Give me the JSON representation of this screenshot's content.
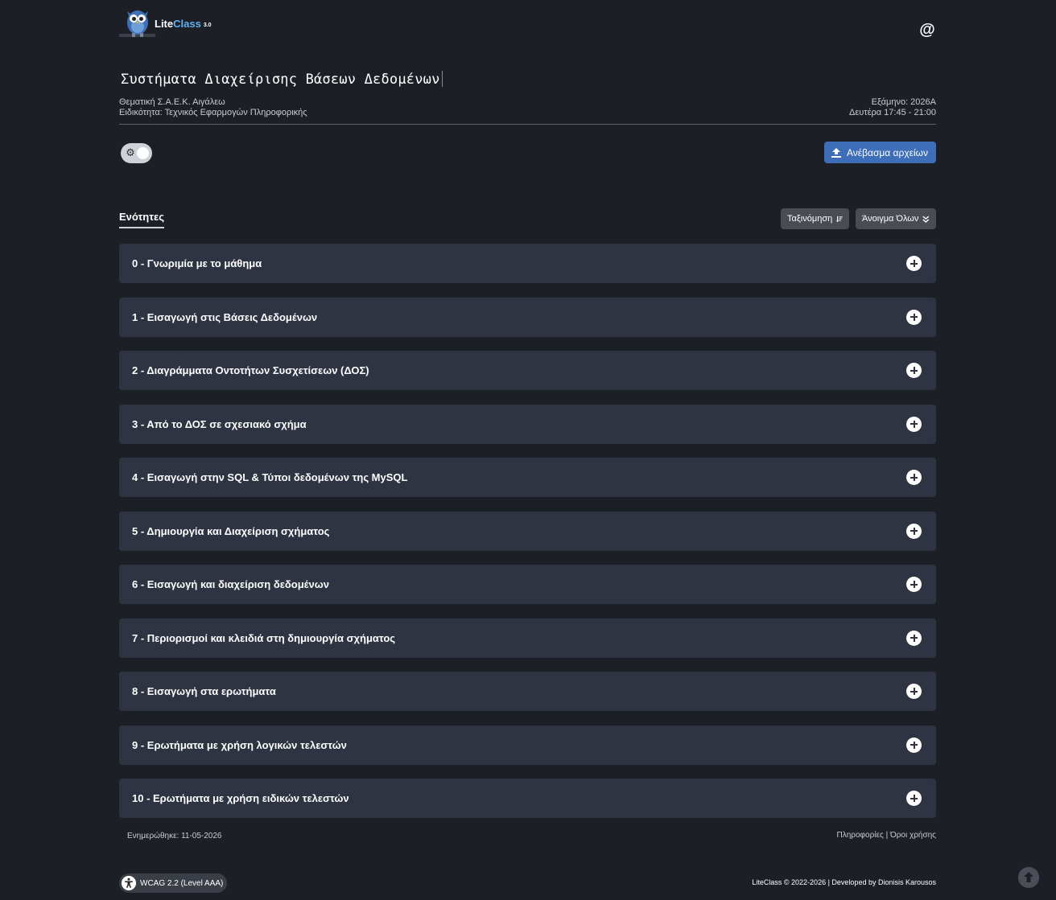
{
  "header": {
    "brand_lite": "Lite",
    "brand_class": "Class",
    "brand_version": "3.0",
    "contact_icon": "@"
  },
  "course": {
    "title": "Συστήματα Διαχείρισης Βάσεων Δεδομένων",
    "school": "Θεματική Σ.Α.Ε.Κ. Αιγάλεω",
    "specialty": "Ειδικότητα: Τεχνικός Εφαρμογών Πληροφορικής",
    "semester": "Εξάμηνο: 2026Α",
    "schedule": "Δευτέρα 17:45 - 21:00"
  },
  "toolbar": {
    "upload_label": "Ανέβασμα αρχείων"
  },
  "sections": {
    "title": "Ενότητες",
    "sort_label": "Ταξινόμηση",
    "open_all_label": "Άνοιγμα Όλων",
    "items": [
      "0 - Γνωριμία με το μάθημα",
      "1 - Εισαγωγή στις Βάσεις Δεδομένων",
      "2 - Διαγράμματα Οντοτήτων Συσχετίσεων (ΔΟΣ)",
      "3 - Από το ΔΟΣ σε σχεσιακό σχήμα",
      "4 - Εισαγωγή στην SQL & Τύποι δεδομένων της MySQL",
      "5 - Δημιουργία και Διαχείριση σχήματος",
      "6 - Εισαγωγή και διαχείριση δεδομένων",
      "7 - Περιορισμοί και κλειδιά στη δημιουργία σχήματος",
      "8 - Εισαγωγή στα ερωτήματα",
      "9 - Ερωτήματα με χρήση λογικών τελεστών",
      "10 - Ερωτήματα με χρήση ειδικών τελεστών"
    ]
  },
  "footer": {
    "updated": "Ενημερώθηκε: 11-05-2026",
    "info_link": "Πληροφορίες",
    "separator": "|",
    "terms_link": "Όροι χρήσης",
    "wcag_label": "WCAG 2.2 (Level AAA)",
    "copyright": "LiteClass © 2022-2026 | Developed by Dionisis Karousos"
  },
  "icons": {
    "logo": "owl-logo",
    "contact": "at-icon",
    "theme": "gear-icon",
    "upload": "upload-icon",
    "sort": "sort-icon",
    "open_all": "double-chevron-down-icon",
    "expand": "plus-circle-icon",
    "accessibility": "accessibility-icon",
    "scroll_top": "arrow-up-circle-icon"
  },
  "colors": {
    "background": "#1c1f26",
    "section_bg": "#2e3442",
    "accent": "#3e6eb8",
    "brand_class": "#5fb0f0"
  }
}
